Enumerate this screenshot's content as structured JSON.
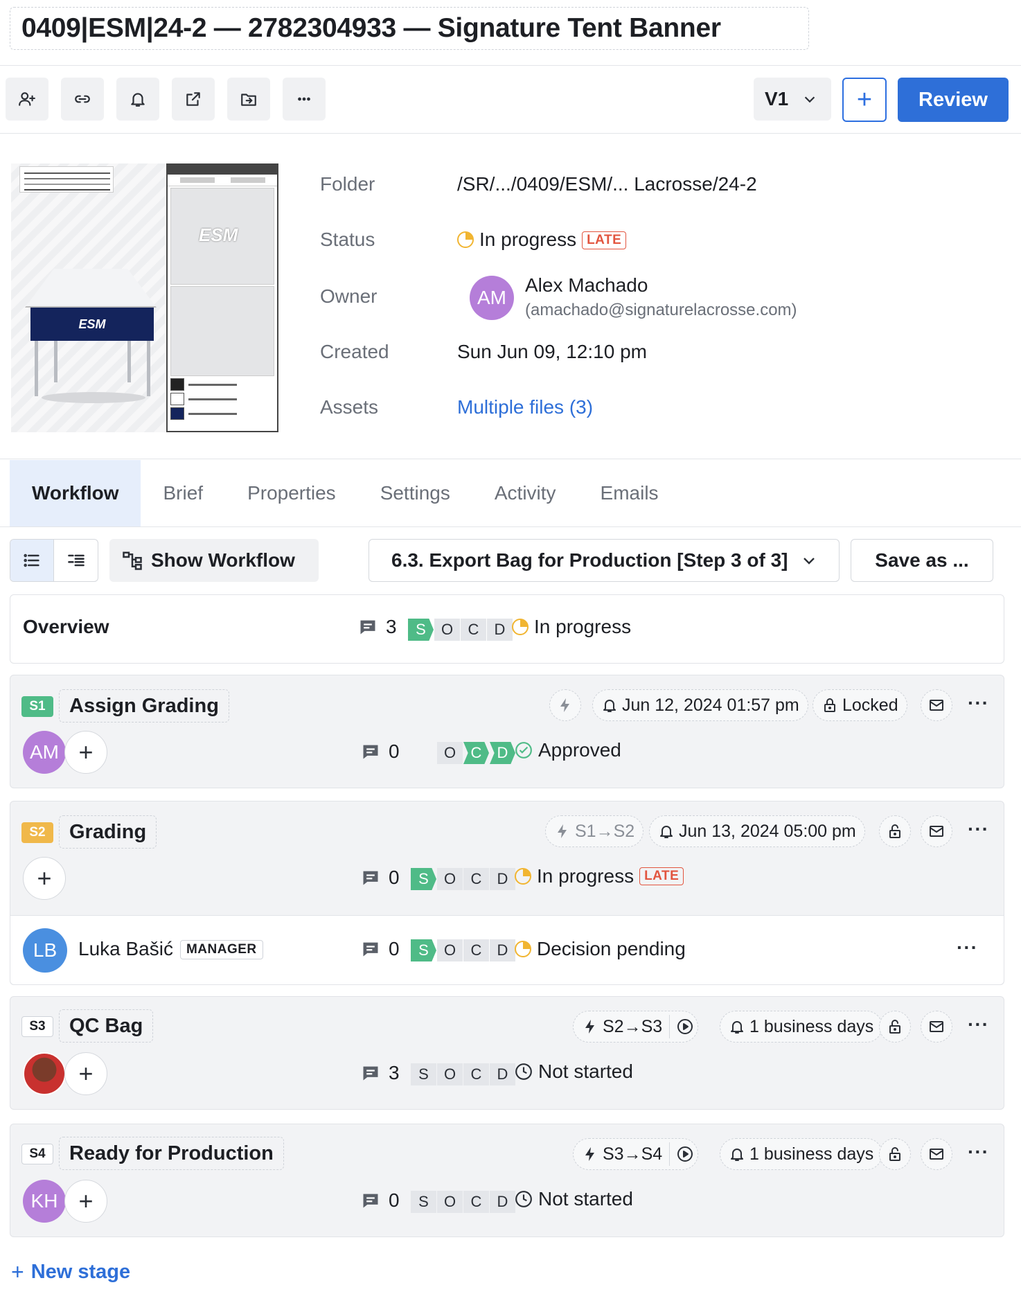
{
  "title": "0409|ESM|24-2 — 2782304933 — Signature Tent Banner",
  "toolbar": {
    "icons": [
      "add-user-icon",
      "link-icon",
      "bell-icon",
      "share-icon",
      "move-folder-icon",
      "more-icon"
    ],
    "version": "V1",
    "plus": "+",
    "review": "Review"
  },
  "preview": {
    "tent_text": "ESM",
    "logo_text": "ESM"
  },
  "meta": {
    "folder_label": "Folder",
    "folder_value": "/SR/.../0409/ESM/... Lacrosse/24-2",
    "status_label": "Status",
    "status_value": "In progress",
    "status_badge": "LATE",
    "owner_label": "Owner",
    "owner_initials": "AM",
    "owner_name": "Alex Machado",
    "owner_email": "(amachado@signaturelacrosse.com)",
    "created_label": "Created",
    "created_value": "Sun Jun 09, 12:10 pm",
    "assets_label": "Assets",
    "assets_value": "Multiple files (3)"
  },
  "tabs": [
    "Workflow",
    "Brief",
    "Properties",
    "Settings",
    "Activity",
    "Emails"
  ],
  "controls": {
    "show_workflow": "Show Workflow",
    "step": "6.3. Export Bag for Production [Step 3 of 3]",
    "save_as": "Save as ..."
  },
  "overview": {
    "label": "Overview",
    "comments": "3",
    "socd": [
      "S",
      "O",
      "C",
      "D"
    ],
    "status": "In progress"
  },
  "stages": [
    {
      "badge": "S1",
      "color": "#4fbb87",
      "name": "Assign Grading",
      "trigger": "",
      "due": "Jun 12, 2024 01:57 pm",
      "lock": "Locked",
      "avatar": "AM",
      "avatar_color": "#b57ed9",
      "comments": "0",
      "socd": [
        "O",
        "C",
        "D"
      ],
      "status": "Approved"
    },
    {
      "badge": "S2",
      "color": "#f0b84a",
      "name": "Grading",
      "trigger": "S1→S2",
      "due": "Jun 13, 2024 05:00 pm",
      "comments": "0",
      "socd": [
        "S",
        "O",
        "C",
        "D"
      ],
      "status": "In progress",
      "late": "LATE",
      "member": {
        "initials": "LB",
        "name": "Luka Bašić",
        "role": "MANAGER",
        "comments": "0",
        "socd": [
          "S",
          "O",
          "C",
          "D"
        ],
        "status": "Decision pending"
      }
    },
    {
      "badge": "S3",
      "name": "QC Bag",
      "trigger": "S2→S3",
      "due": "1 business days",
      "comments": "3",
      "socd": [
        "S",
        "O",
        "C",
        "D"
      ],
      "status": "Not started"
    },
    {
      "badge": "S4",
      "name": "Ready for Production",
      "trigger": "S3→S4",
      "due": "1 business days",
      "avatar": "KH",
      "avatar_color": "#b57ed9",
      "comments": "0",
      "socd": [
        "S",
        "O",
        "C",
        "D"
      ],
      "status": "Not started"
    }
  ],
  "new_stage": "New stage",
  "colors": {
    "accent": "#2e6fd8",
    "approved_green": "#4fbb87",
    "progress_yellow": "#f1b531",
    "late_red": "#e2553f"
  }
}
